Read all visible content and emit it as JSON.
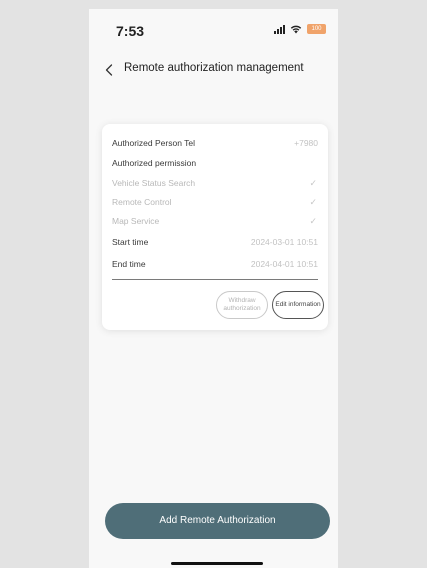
{
  "status_bar": {
    "time": "7:53",
    "battery": "100",
    "icons": [
      "signal-icon",
      "wifi-icon",
      "battery-icon"
    ]
  },
  "header": {
    "title": "Remote authorization management",
    "back_icon": "chevron-left-icon"
  },
  "card": {
    "tel_label": "Authorized Person Tel",
    "tel_value": "+7980",
    "permission_title": "Authorized permission",
    "permissions": [
      {
        "label": "Vehicle Status Search",
        "icon": "check-icon"
      },
      {
        "label": "Remote Control",
        "icon": "check-icon"
      },
      {
        "label": "Map Service",
        "icon": "check-icon"
      }
    ],
    "start_label": "Start time",
    "start_value": "2024-03-01 10:51",
    "end_label": "End time",
    "end_value": "2024-04-01 10:51",
    "withdraw_label": "Withdraw authorization",
    "edit_label": "Edit information"
  },
  "footer": {
    "add_button_label": "Add Remote Authorization"
  },
  "colors": {
    "accent": "#4f6e78",
    "background": "#f8f8f8",
    "card": "#ffffff",
    "battery": "#f0a36a"
  }
}
